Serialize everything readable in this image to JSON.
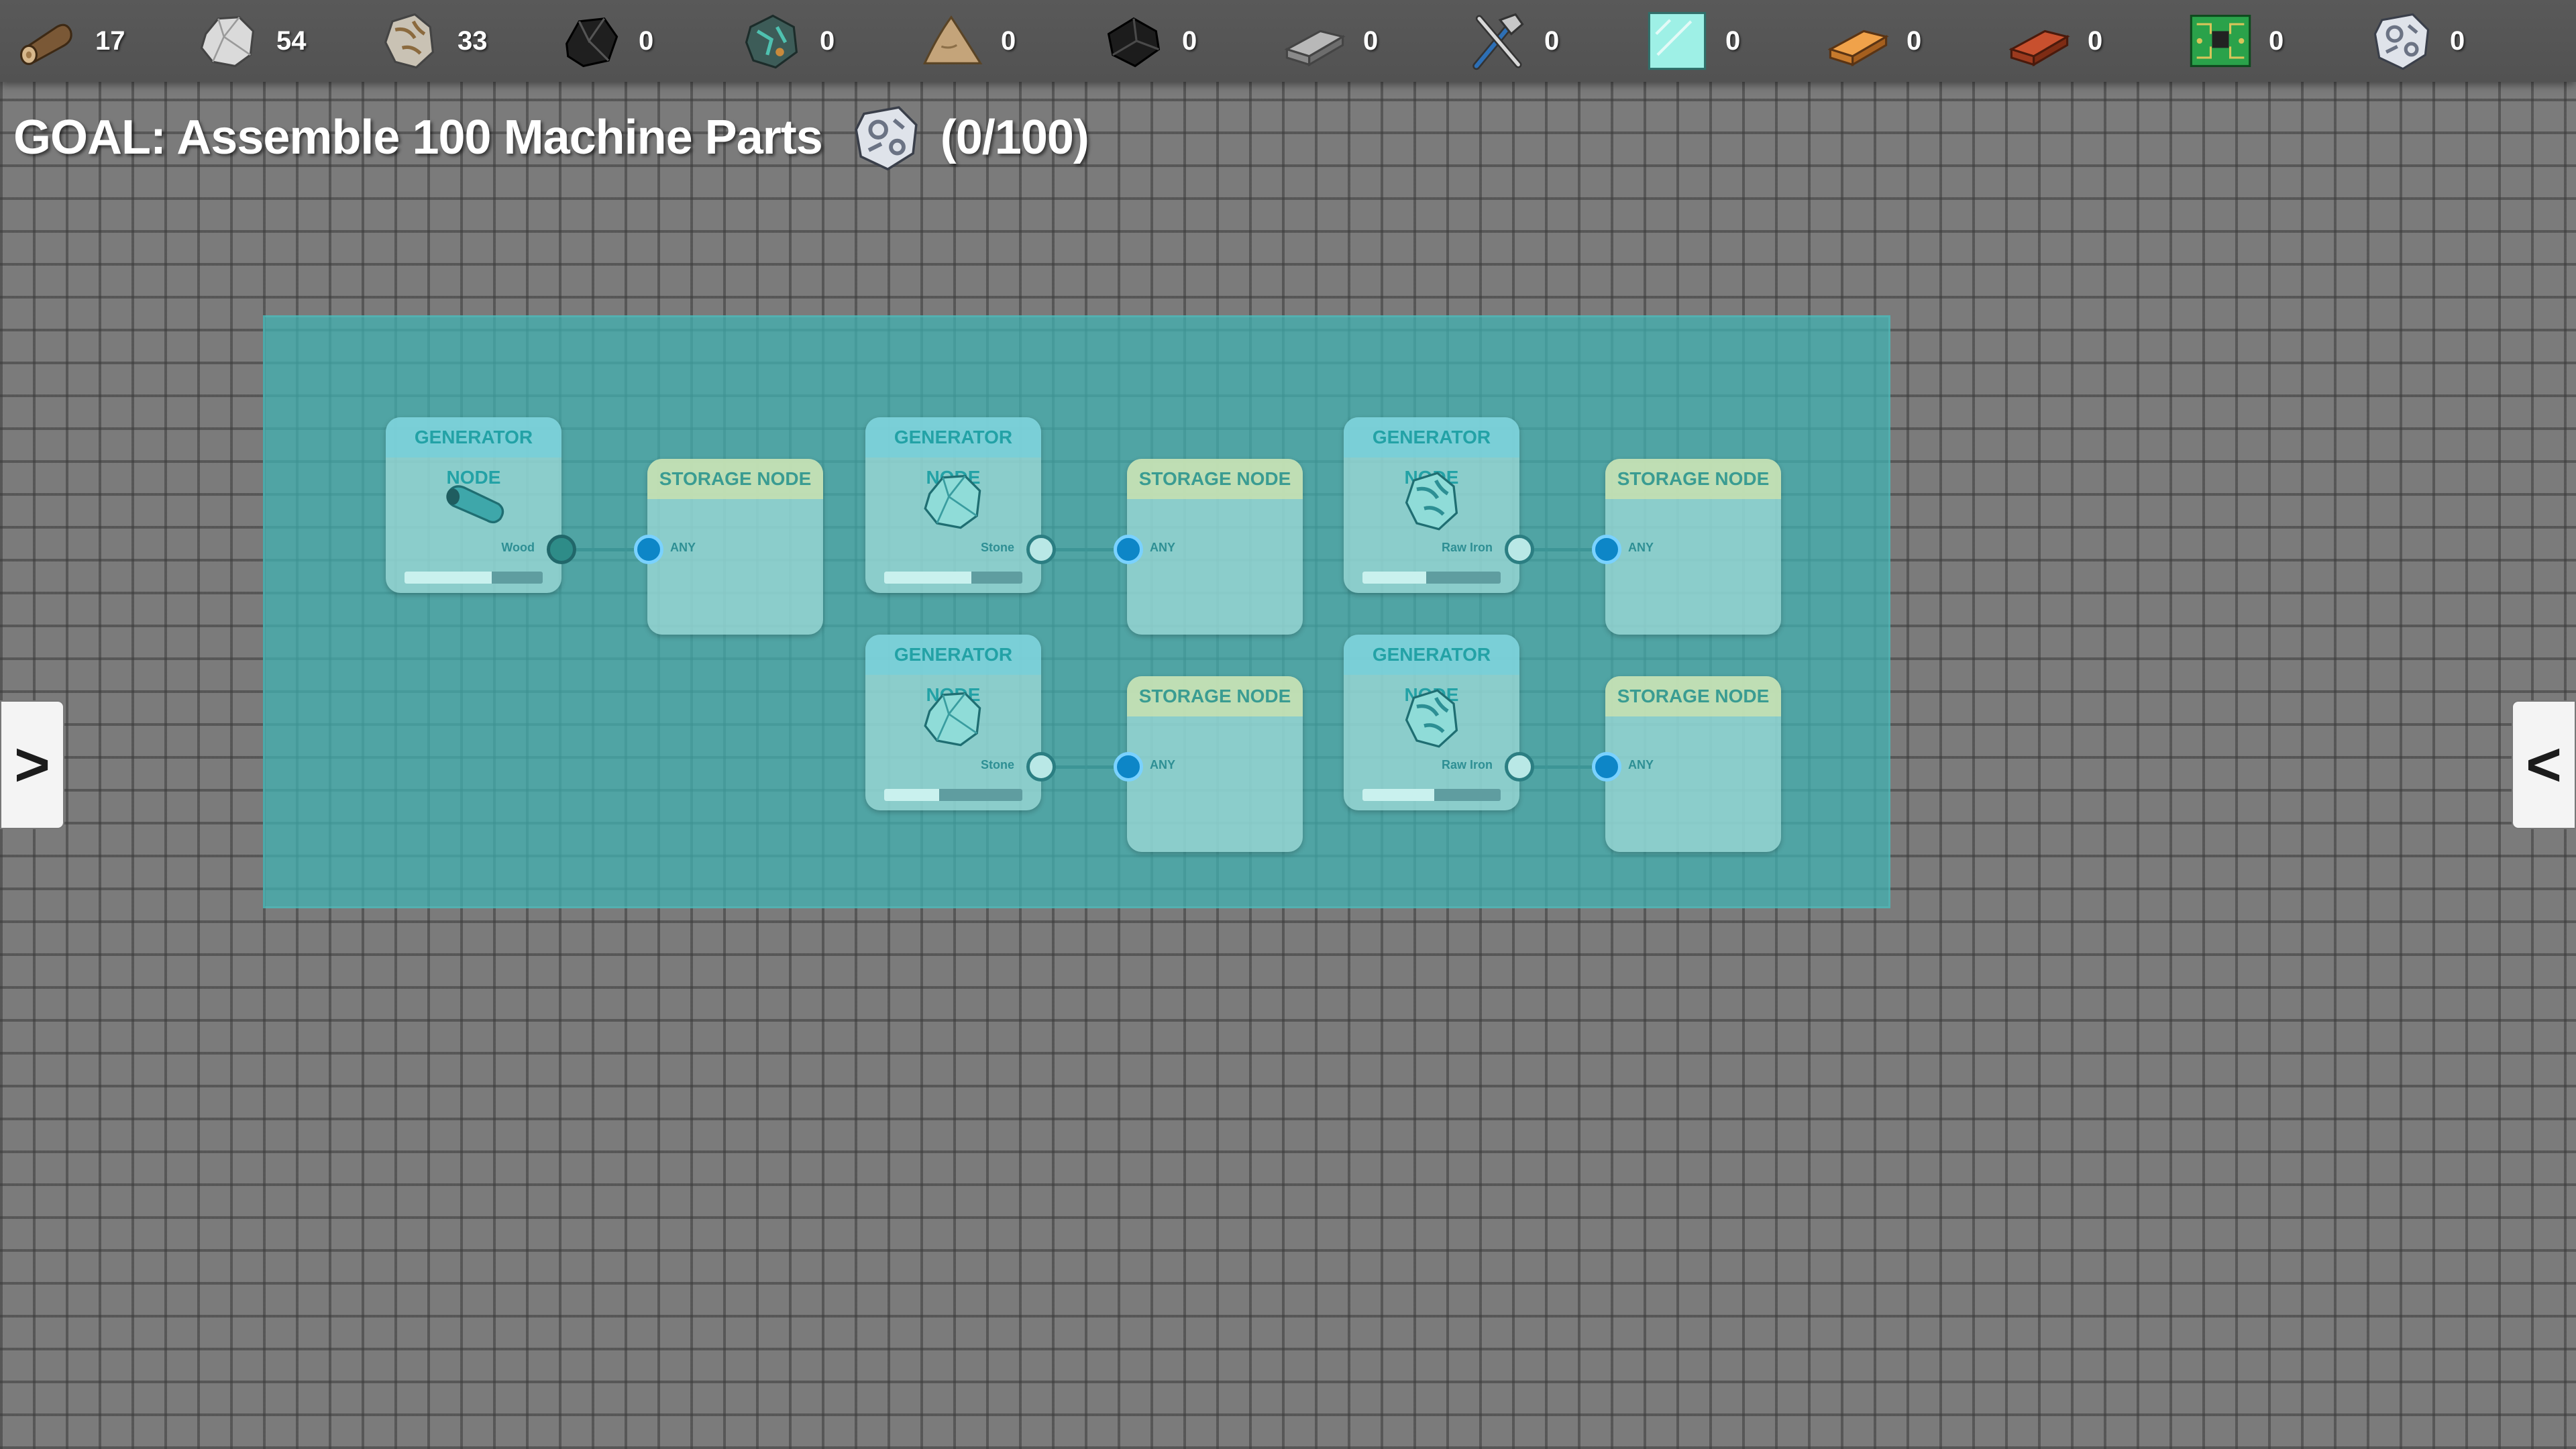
{
  "resources": [
    {
      "name": "wood-icon",
      "count": "17"
    },
    {
      "name": "stone-icon",
      "count": "54"
    },
    {
      "name": "raw-iron-icon",
      "count": "33"
    },
    {
      "name": "coal-icon",
      "count": "0"
    },
    {
      "name": "raw-copper-icon",
      "count": "0"
    },
    {
      "name": "sand-icon",
      "count": "0"
    },
    {
      "name": "rubber-icon",
      "count": "0"
    },
    {
      "name": "iron-ingot-icon",
      "count": "0"
    },
    {
      "name": "tools-icon",
      "count": "0"
    },
    {
      "name": "glass-icon",
      "count": "0"
    },
    {
      "name": "copper-ingot-icon",
      "count": "0"
    },
    {
      "name": "brick-icon",
      "count": "0"
    },
    {
      "name": "circuit-board-icon",
      "count": "0"
    },
    {
      "name": "machine-part-icon",
      "count": "0"
    }
  ],
  "goal": {
    "text": "GOAL: Assemble 100 Machine Parts",
    "icon": "machine-part-icon",
    "progress": "(0/100)"
  },
  "nodes": {
    "generator_title": "GENERATOR NODE",
    "storage_title": "STORAGE NODE",
    "storage_port_label": "ANY",
    "generators": [
      {
        "resource": "Wood",
        "icon": "wood-icon",
        "progress": 0.63
      },
      {
        "resource": "Stone",
        "icon": "stone-icon",
        "progress": 0.63
      },
      {
        "resource": "Raw Iron",
        "icon": "raw-iron-icon",
        "progress": 0.46
      },
      {
        "resource": "Stone",
        "icon": "stone-icon",
        "progress": 0.4
      },
      {
        "resource": "Raw Iron",
        "icon": "raw-iron-icon",
        "progress": 0.52
      }
    ]
  },
  "nav": {
    "left": ">",
    "right": "<"
  },
  "colors": {
    "zone": "#3eb6b6",
    "port_in": "#0d86c7",
    "title_text": "#23a2a6"
  }
}
